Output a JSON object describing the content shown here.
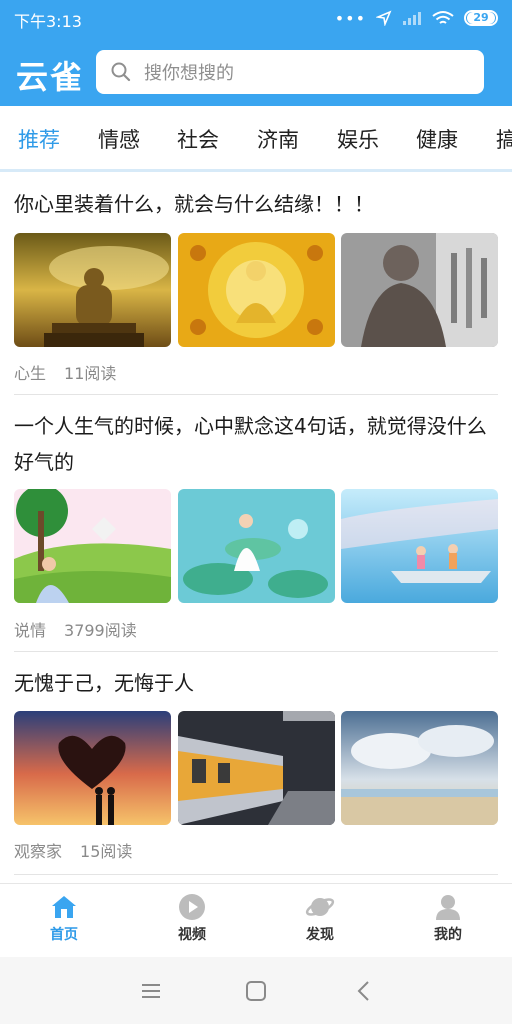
{
  "status": {
    "time": "下午3:13",
    "dots": "•••",
    "battery": "29"
  },
  "app": {
    "logo": "云雀"
  },
  "search": {
    "placeholder": "搜你想搜的"
  },
  "tabs": [
    {
      "label": "推荐",
      "active": true
    },
    {
      "label": "情感"
    },
    {
      "label": "社会"
    },
    {
      "label": "济南"
    },
    {
      "label": "娱乐"
    },
    {
      "label": "健康"
    },
    {
      "label": "搞"
    }
  ],
  "articles": [
    {
      "title": "你心里装着什么，就会与什么结缘！！！",
      "source": "心生",
      "reads": "11阅读"
    },
    {
      "title": "一个人生气的时候，心中默念这4句话，就觉得没什么好气的",
      "source": "说情",
      "reads": "3799阅读"
    },
    {
      "title": "无愧于己，无悔于人",
      "source": "观察家",
      "reads": "15阅读"
    }
  ],
  "bottom_nav": [
    {
      "label": "首页",
      "icon": "home-icon",
      "active": true
    },
    {
      "label": "视频",
      "icon": "video-play-icon"
    },
    {
      "label": "发现",
      "icon": "planet-icon"
    },
    {
      "label": "我的",
      "icon": "profile-icon"
    }
  ],
  "colors": {
    "brand": "#3aa5f0",
    "active_tab": "#2f9be8",
    "text": "#1b1b1b",
    "meta": "#8a8a8a"
  }
}
